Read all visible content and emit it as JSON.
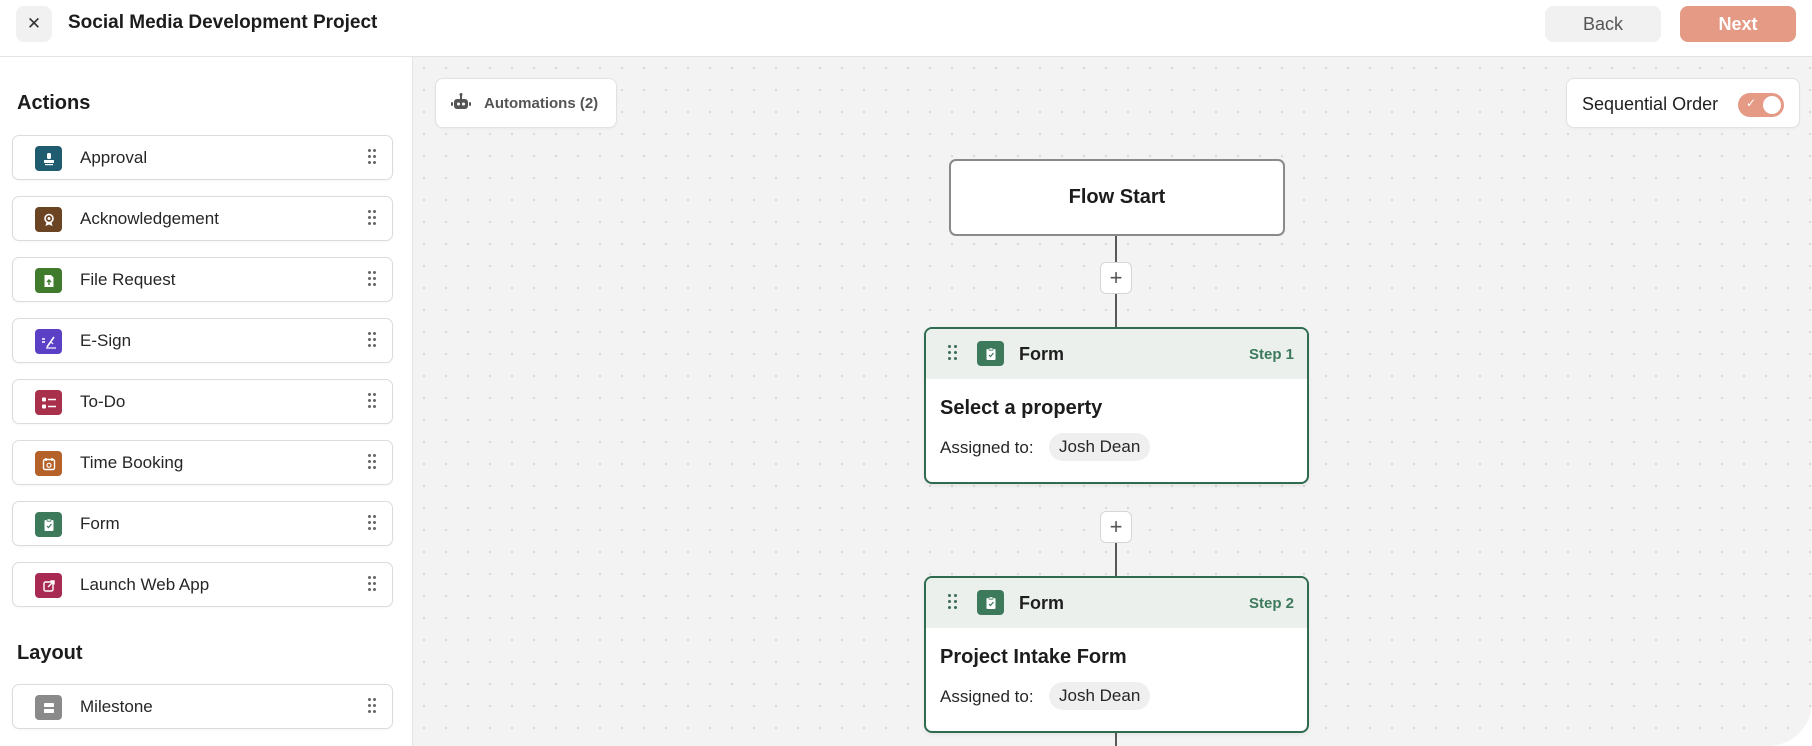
{
  "header": {
    "close_icon": "close-icon",
    "title": "Social Media Development Project",
    "back_label": "Back",
    "next_label": "Next"
  },
  "sidebar": {
    "actions_title": "Actions",
    "actions": [
      {
        "label": "Approval",
        "icon": "stamp-icon",
        "color": "#1f5c6f"
      },
      {
        "label": "Acknowledgement",
        "icon": "badge-icon",
        "color": "#6b4424"
      },
      {
        "label": "File Request",
        "icon": "file-upload-icon",
        "color": "#3f7a2d"
      },
      {
        "label": "E-Sign",
        "icon": "signature-icon",
        "color": "#5b3fc4"
      },
      {
        "label": "To-Do",
        "icon": "checklist-icon",
        "color": "#a8304a"
      },
      {
        "label": "Time Booking",
        "icon": "calendar-icon",
        "color": "#b5622a"
      },
      {
        "label": "Form",
        "icon": "clipboard-icon",
        "color": "#3d7a5c"
      },
      {
        "label": "Launch Web App",
        "icon": "external-link-icon",
        "color": "#a82a52"
      }
    ],
    "layout_title": "Layout",
    "layout": [
      {
        "label": "Milestone",
        "icon": "milestone-icon",
        "color": "#8a8a8a"
      }
    ]
  },
  "canvas": {
    "automations_label": "Automations (2)",
    "sequential_label": "Sequential Order",
    "sequential_on": true,
    "flow_start_label": "Flow Start",
    "steps": [
      {
        "type": "Form",
        "step": "Step 1",
        "title": "Select a property",
        "assigned_label": "Assigned to:",
        "assignee": "Josh Dean"
      },
      {
        "type": "Form",
        "step": "Step 2",
        "title": "Project Intake Form",
        "assigned_label": "Assigned to:",
        "assignee": "Josh Dean"
      }
    ]
  },
  "colors": {
    "accent": "#e59a85",
    "step_border": "#2e6b4f",
    "step_header": "#ebf0ed"
  }
}
